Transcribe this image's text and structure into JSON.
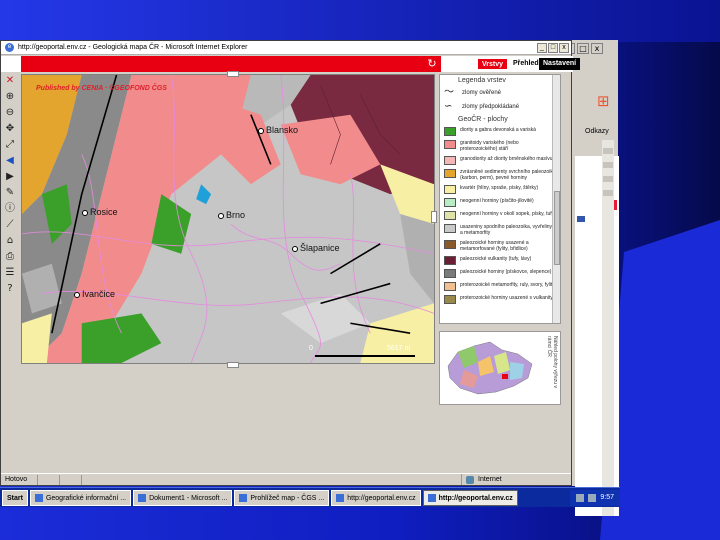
{
  "window": {
    "title": "http://geoportal.env.cz - Geologická mapa ČR - Microsoft Internet Explorer",
    "controls": [
      "_",
      "□",
      "x"
    ],
    "status_left": "Hotovo",
    "status_zone": "Internet"
  },
  "background_window": {
    "controls": [
      "_",
      "□",
      "x"
    ],
    "links_label": "Odkazy"
  },
  "app_header": {
    "refresh_icon": "refresh-icon",
    "btn_layers": "Vrstvy",
    "btn_overview": "Přehled",
    "btn_settings": "Nastavení",
    "colors": {
      "header_red": "#e80012"
    }
  },
  "toolbar": {
    "tools": [
      "close-icon",
      "zoom-in-icon",
      "zoom-out-icon",
      "pan-icon",
      "full-extent-icon",
      "back-icon",
      "forward-icon",
      "identify-icon",
      "info-icon",
      "measure-icon",
      "select-icon",
      "print-icon",
      "legend-icon",
      "help-icon"
    ]
  },
  "map": {
    "credit": "Published by CENIA · ©GEOFOND ČGS",
    "cities": {
      "brno": "Brno",
      "rosice": "Rosice",
      "slapanice": "Šlapanice",
      "blansko": "Blansko",
      "ivancice": "Ivančice"
    },
    "scale_start": "0",
    "scale_end": "5617 m"
  },
  "legend": {
    "heading": "Legenda vrstev",
    "line_items": [
      "zlomy ověřené",
      "zlomy předpokládané"
    ],
    "area_heading": "GeoČR - plochy",
    "items": [
      {
        "color": "#3aa02a",
        "label": "diority a gabra devonská a variská"
      },
      {
        "color": "#f28c8c",
        "label": "granitoidy variského (nebo proterozoického) stáří"
      },
      {
        "color": "#f5b6b6",
        "label": "granodiority až diority brněnského masívu"
      },
      {
        "color": "#e3a52e",
        "label": "zvrásněné sedimenty svrchního paleozoika (karbon, perm), pevné horniny"
      },
      {
        "color": "#f7efa3",
        "label": "kvartér (hlíny, spraše, písky, štěrky)"
      },
      {
        "color": "#b7ecc4",
        "label": "neogenní horniny (písčito-jílovité)"
      },
      {
        "color": "#dfe3a8",
        "label": "neogenní horniny v okolí sopek, písky, tufy"
      },
      {
        "color": "#c9c9c9",
        "label": "usazeniny spodního paleozoika, vyvřeliny a metamorfity"
      },
      {
        "color": "#8b5a2b",
        "label": "paleozoické horniny usazené a metamorfované (fylity, břidlice)"
      },
      {
        "color": "#6b1f35",
        "label": "paleozoické vulkanity (tufy, lávy)"
      },
      {
        "color": "#7a7a7a",
        "label": "paleozoické horniny (pískovce, slepence)"
      },
      {
        "color": "#f0c090",
        "label": "proterozoické metamorfity, ruly, svory, fylity"
      },
      {
        "color": "#9a8a4a",
        "label": "proterozoické horniny usazené s vulkanity"
      }
    ]
  },
  "overview": {
    "side_text": "Náhled polohy výřezu v rámci ČR"
  },
  "taskbar": {
    "start": "Start",
    "items": [
      "Geografické informační ...",
      "Dokument1 - Microsoft ...",
      "Prohlížeč map - ČGS ...",
      "http://geoportal.env.cz",
      "http://geoportal.env.cz"
    ],
    "active_index": 4,
    "clock": "9:57"
  }
}
